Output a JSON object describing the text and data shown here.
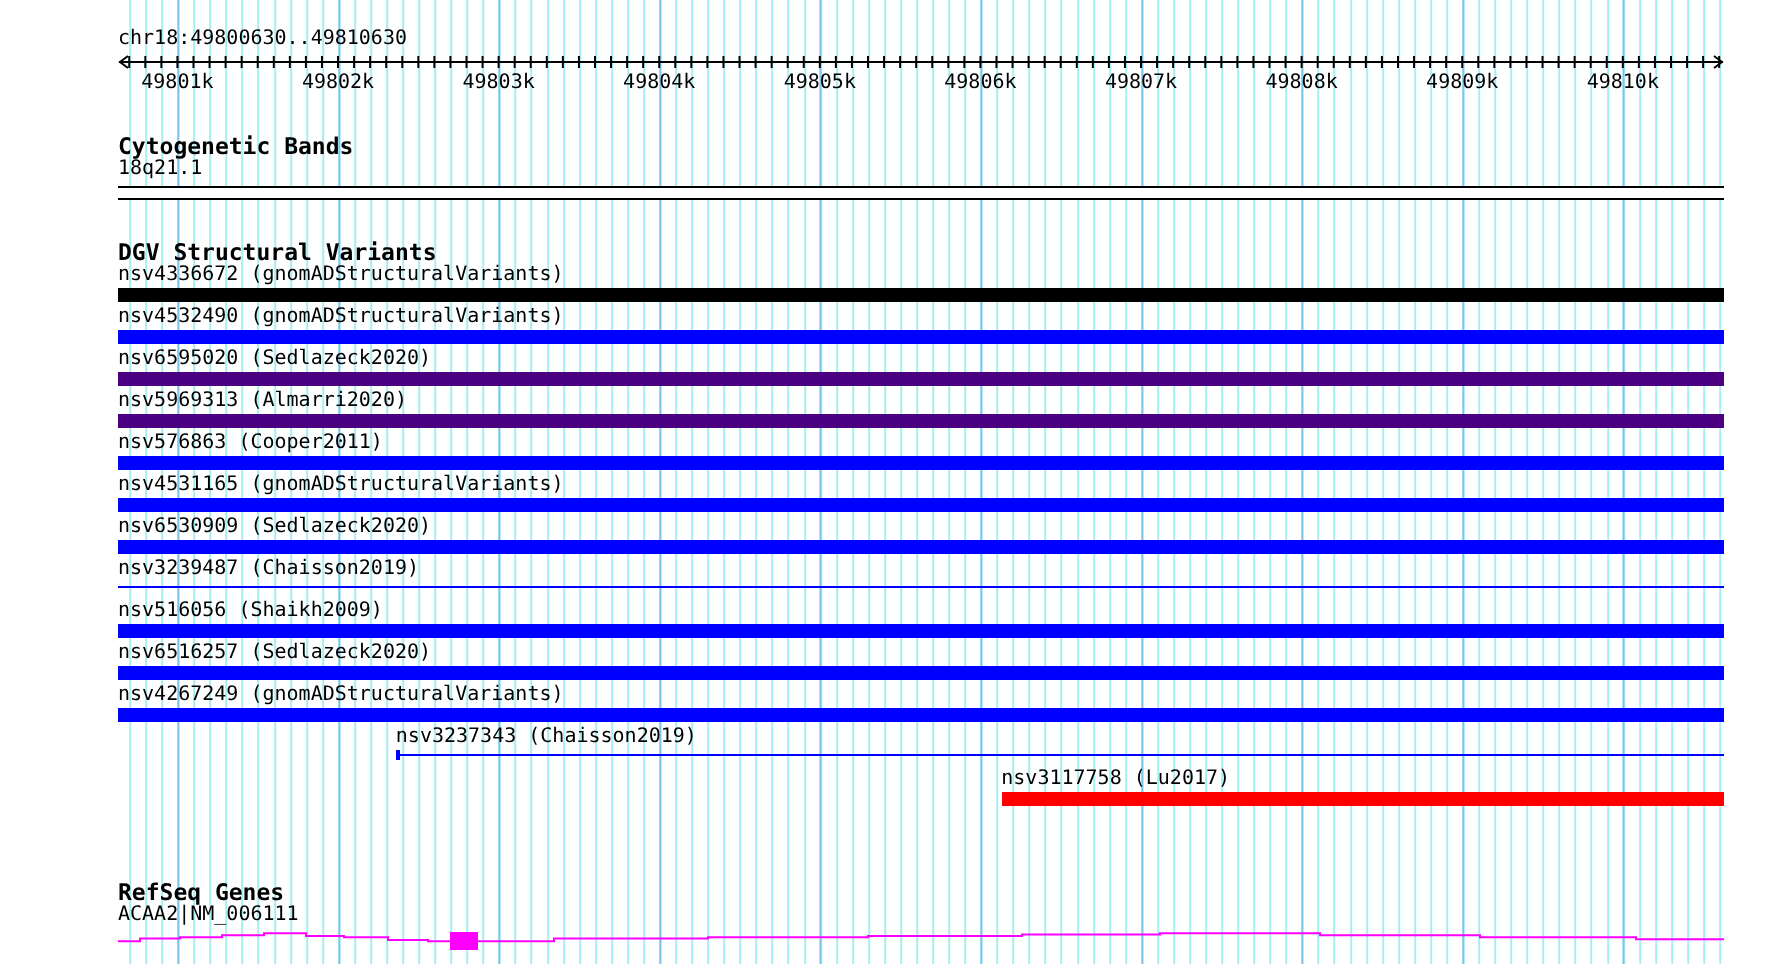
{
  "ruler": {
    "location": "chr18:49800630..49810630",
    "tick_labels": [
      "49801k",
      "49802k",
      "49803k",
      "49804k",
      "49805k",
      "49806k",
      "49807k",
      "49808k",
      "49809k",
      "49810k"
    ]
  },
  "tracks": [
    {
      "title": "Cytogenetic Bands",
      "kind": "bands",
      "features": [
        {
          "label": "18q21.1"
        }
      ]
    },
    {
      "title": "DGV Structural Variants",
      "kind": "variants",
      "features": [
        {
          "label": "nsv4336672 (gnomADStructuralVariants)",
          "kind": "thick",
          "color": "#000000",
          "level": 1
        },
        {
          "label": "nsv4532490 (gnomADStructuralVariants)",
          "kind": "thick",
          "color": "#0000ff",
          "level": 1
        },
        {
          "label": "nsv6595020 (Sedlazeck2020)",
          "kind": "thick",
          "color": "#4b0082",
          "level": 1
        },
        {
          "label": "nsv5969313 (Almarri2020)",
          "kind": "thick",
          "color": "#4b0082",
          "level": 1
        },
        {
          "label": "nsv576863 (Cooper2011)",
          "kind": "thick",
          "color": "#0000ff",
          "level": 1
        },
        {
          "label": "nsv4531165 (gnomADStructuralVariants)",
          "kind": "thick",
          "color": "#0000ff",
          "level": 1
        },
        {
          "label": "nsv6530909 (Sedlazeck2020)",
          "kind": "thick",
          "color": "#0000ff",
          "level": 1
        },
        {
          "label": "nsv3239487 (Chaisson2019)",
          "kind": "thin",
          "color": "#0000ff",
          "level": 1
        },
        {
          "label": "nsv516056 (Shaikh2009)",
          "kind": "thick",
          "color": "#0000ff",
          "level": 1
        },
        {
          "label": "nsv6516257 (Sedlazeck2020)",
          "kind": "thick",
          "color": "#0000ff",
          "level": 1
        },
        {
          "label": "nsv4267249 (gnomADStructuralVariants)",
          "kind": "thick",
          "color": "#0000ff",
          "level": 1
        },
        {
          "label": "nsv3237343 (Chaisson2019)",
          "kind": "thin",
          "color": "#0000ff",
          "level": 0.827
        },
        {
          "label": "nsv3117758 (Lu2017)",
          "kind": "thick",
          "color": "#ff0000",
          "level": 0.45
        }
      ]
    },
    {
      "title": "RefSeq Genes",
      "kind": "genes",
      "features": [
        {
          "label": "ACAA2|NM_006111"
        }
      ]
    }
  ]
}
